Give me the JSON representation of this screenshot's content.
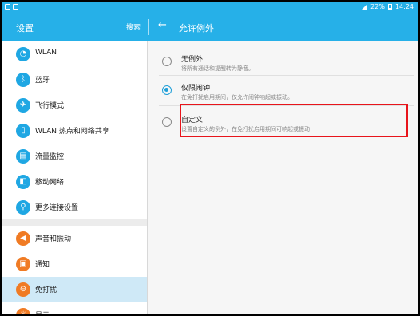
{
  "status_bar": {
    "battery": "22%",
    "time": "14:24"
  },
  "app_bar": {
    "left_title": "设置",
    "search_label": "搜索",
    "back_icon": "←",
    "right_title": "允许例外"
  },
  "sidebar": {
    "items": [
      {
        "label": "WLAN",
        "icon": "wifi-icon",
        "color": "#1fa7e3",
        "glyph": "◔"
      },
      {
        "label": "蓝牙",
        "icon": "bluetooth-icon",
        "color": "#1fa7e3",
        "glyph": "ᛒ"
      },
      {
        "label": "飞行模式",
        "icon": "airplane-icon",
        "color": "#1fa7e3",
        "glyph": "✈"
      },
      {
        "label": "WLAN 热点和网络共享",
        "icon": "hotspot-icon",
        "color": "#1fa7e3",
        "glyph": "▯"
      },
      {
        "label": "流量监控",
        "icon": "data-usage-icon",
        "color": "#1fa7e3",
        "glyph": "▤"
      },
      {
        "label": "移动网络",
        "icon": "mobile-network-icon",
        "color": "#1fa7e3",
        "glyph": "◧"
      },
      {
        "label": "更多连接设置",
        "icon": "more-connections-icon",
        "color": "#1fa7e3",
        "glyph": "⚲"
      },
      {
        "label": "声音和振动",
        "icon": "sound-icon",
        "color": "#f07b24",
        "glyph": "◀"
      },
      {
        "label": "通知",
        "icon": "notification-icon",
        "color": "#f07b24",
        "glyph": "▣"
      },
      {
        "label": "免打扰",
        "icon": "do-not-disturb-icon",
        "color": "#f07b24",
        "glyph": "⊖"
      },
      {
        "label": "显示",
        "icon": "display-icon",
        "color": "#f07b24",
        "glyph": "☼"
      }
    ],
    "active_index": 9
  },
  "options": [
    {
      "title": "无例外",
      "desc": "将所有通话和提醒转为静音。",
      "selected": false
    },
    {
      "title": "仅限闹钟",
      "desc": "在免打扰启用期间，仅允许闹钟响起或振动。",
      "selected": true
    },
    {
      "title": "自定义",
      "desc": "设置自定义的例外，在免打扰启用期间可响起或振动",
      "selected": false
    }
  ],
  "colors": {
    "accent": "#26b0e8",
    "highlight": "#e8141b"
  }
}
